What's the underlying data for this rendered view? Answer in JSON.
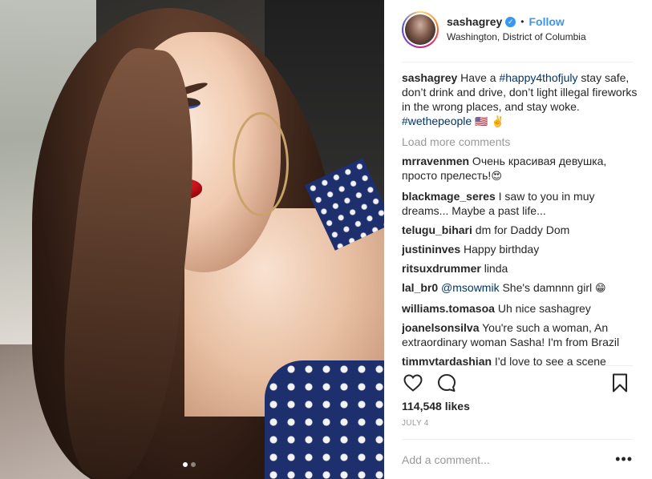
{
  "post": {
    "username": "sashagrey",
    "follow_label": "Follow",
    "bullet": "•",
    "location": "Washington, District of Columbia",
    "caption_text_1": " Have a ",
    "caption_tag_1": "#happy4thofjuly",
    "caption_text_2": " stay safe, don’t drink and drive, don’t light illegal fireworks in the wrong places, and stay woke. ",
    "caption_tag_2": "#wethepeople",
    "caption_emoji": " 🇺🇸 ✌️",
    "load_more": "Load more comments",
    "likes": "114,548 likes",
    "date": "JULY 4",
    "comment_placeholder": "Add a comment...",
    "more_label": "•••"
  },
  "comments": [
    {
      "user": "mrravenmen",
      "text": " Очень красивая девушка, просто прелесть!",
      "emoji": "😍"
    },
    {
      "user": "blackmage_seres",
      "text": " I saw to you in muy dreams... Maybe a past life...",
      "emoji": ""
    },
    {
      "user": "telugu_bihari",
      "text": " dm for Daddy Dom",
      "emoji": ""
    },
    {
      "user": "justininves",
      "text": " Happy birthday",
      "emoji": ""
    },
    {
      "user": "ritsuxdrummer",
      "text": " linda",
      "emoji": ""
    },
    {
      "user": "lal_br0",
      "mention": "@msowmik",
      "text": " She's damnnn girl ",
      "emoji": "😁"
    },
    {
      "user": "williams.tomasoa",
      "text": " Uh nice sashagrey",
      "emoji": ""
    },
    {
      "user": "joanelsonsilva",
      "text": " You're such a woman, An extraordinary woman Sasha! I'm from Brazil",
      "emoji": ""
    },
    {
      "user": "timmytardashian",
      "text": " I'd love to see a scene",
      "emoji": ""
    }
  ],
  "icons": {
    "verified": "verified-badge-icon",
    "like": "heart-icon",
    "comment": "comment-bubble-icon",
    "save": "bookmark-icon",
    "more": "more-options-icon"
  },
  "colors": {
    "link": "#003569",
    "follow": "#3897f0",
    "muted": "#999999",
    "text": "#262626"
  },
  "carousel": {
    "count": 2,
    "active": 1
  }
}
